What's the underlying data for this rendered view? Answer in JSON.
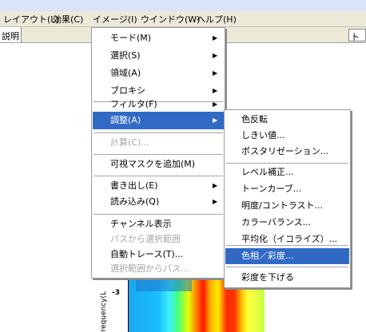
{
  "menubar": {
    "items": [
      {
        "label": "レイアウト(L)"
      },
      {
        "label": "効果(C)"
      },
      {
        "label": "イメージ(I)"
      },
      {
        "label": "ウインドウ(W)"
      },
      {
        "label": "ヘルプ(H)"
      }
    ]
  },
  "panel_header": {
    "left_text": "説明",
    "right_text": "ト"
  },
  "image_menu": {
    "items": [
      {
        "label": "モード(M)"
      },
      {
        "label": "選択(S)"
      },
      {
        "label": "領域(A)"
      },
      {
        "label": "ブロキシ"
      },
      {
        "label": "フィルタ(F)"
      },
      {
        "label": "調整(A)"
      },
      {
        "label": "計算(C)..."
      },
      {
        "label": "可視マスクを追加(M)"
      },
      {
        "label": "書き出し(E)"
      },
      {
        "label": "読み込み(Q)"
      },
      {
        "label": "チャンネル表示"
      },
      {
        "label": "パスから選択範囲"
      },
      {
        "label": "自動トレース(T)..."
      },
      {
        "label": "選択範囲からパス..."
      }
    ]
  },
  "adjust_submenu": {
    "items": [
      {
        "label": "色反転"
      },
      {
        "label": "しきい値..."
      },
      {
        "label": "ポスタリゼーション..."
      },
      {
        "label": "レベル補正..."
      },
      {
        "label": "トーンカーブ..."
      },
      {
        "label": "明度/コントラスト..."
      },
      {
        "label": "カラーバランス..."
      },
      {
        "label": "平均化（イコライズ）..."
      },
      {
        "label": "色相／彩度..."
      },
      {
        "label": "彩度を下げる"
      }
    ]
  },
  "background_plot": {
    "ylabel": "Frequency(Log",
    "ytick": "-3"
  },
  "colors": {
    "highlight": "#316ac5",
    "menubar": "#ece9d8",
    "disabled_text": "#a6a6a6"
  },
  "icons": {
    "submenu_arrow": "▶"
  }
}
